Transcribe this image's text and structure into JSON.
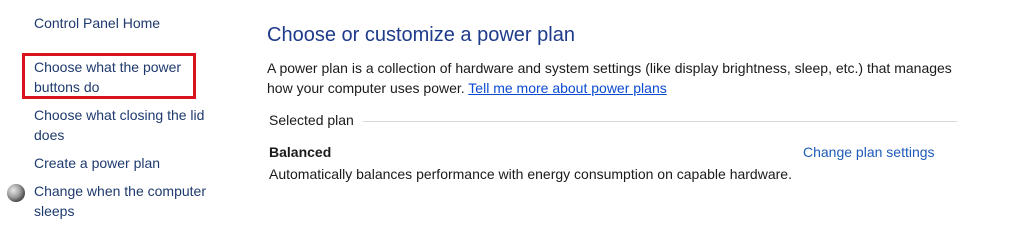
{
  "sidebar": {
    "items": [
      {
        "label": "Control Panel Home"
      },
      {
        "label": "Choose what the power buttons do"
      },
      {
        "label": "Choose what closing the lid does"
      },
      {
        "label": "Create a power plan"
      },
      {
        "label": "Change when the computer sleeps",
        "icon": "moon-icon"
      }
    ]
  },
  "main": {
    "title": "Choose or customize a power plan",
    "description": "A power plan is a collection of hardware and system settings (like display brightness, sleep, etc.) that manages how your computer uses power.",
    "learn_more": "Tell me more about power plans",
    "section_label": "Selected plan",
    "plan": {
      "name": "Balanced",
      "change_link": "Change plan settings",
      "description": "Automatically balances performance with energy consumption on capable hardware."
    }
  },
  "colors": {
    "highlight": "#d9141f",
    "title": "#1e3a8a",
    "link": "#0b4bd1"
  }
}
